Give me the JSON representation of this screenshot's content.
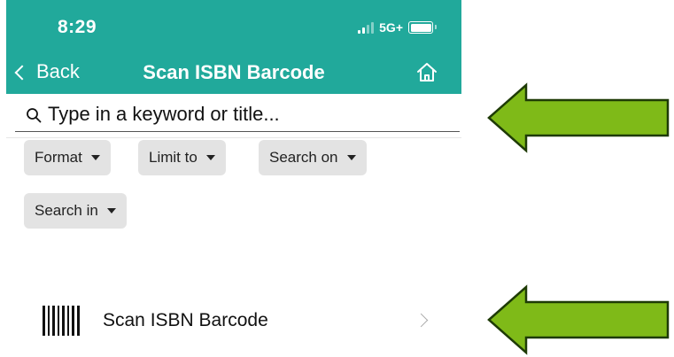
{
  "status_bar": {
    "time": "8:29",
    "network": "5G+"
  },
  "nav": {
    "back_label": "Back",
    "title": "Scan ISBN Barcode",
    "home_icon": "home-icon"
  },
  "search": {
    "placeholder": "Type in a keyword or title..."
  },
  "filters": [
    {
      "label": "Format"
    },
    {
      "label": "Limit to"
    },
    {
      "label": "Search on"
    },
    {
      "label": "Search in"
    }
  ],
  "scan_row": {
    "label": "Scan ISBN Barcode",
    "icon": "barcode-icon"
  },
  "colors": {
    "header": "#21a99b",
    "chip": "#e3e3e3",
    "arrow_fill": "#7fba18",
    "arrow_stroke": "#1e3b06"
  }
}
